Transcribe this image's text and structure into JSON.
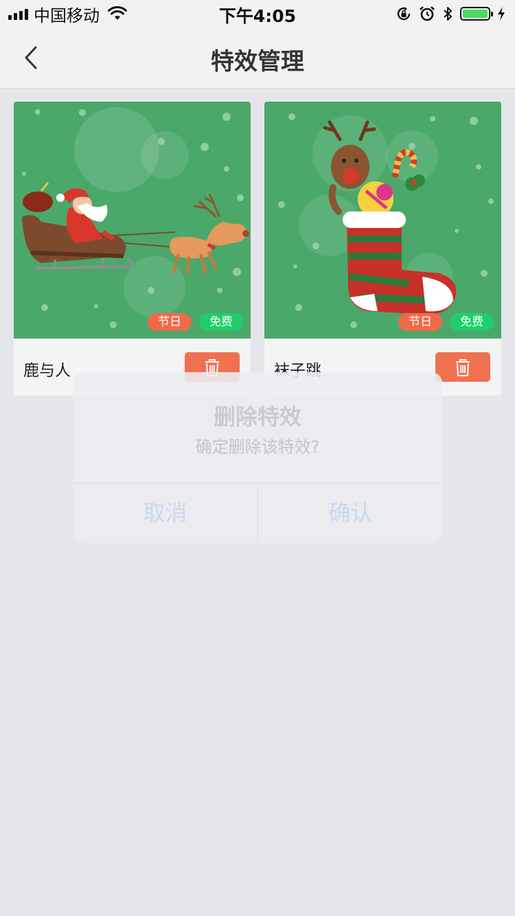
{
  "status_bar": {
    "carrier": "中国移动",
    "time": "下午4:05",
    "battery_level": 1.0,
    "icons": [
      "signal-icon",
      "wifi-icon",
      "rotation-lock-icon",
      "alarm-icon",
      "bluetooth-icon",
      "battery-icon",
      "charging-icon"
    ]
  },
  "nav": {
    "title": "特效管理",
    "back_icon": "chevron-left-icon"
  },
  "effects": [
    {
      "name": "鹿与人",
      "tags": [
        "节日",
        "免费"
      ],
      "delete_icon": "trash-icon"
    },
    {
      "name": "袜子跳",
      "tags": [
        "节日",
        "免费"
      ],
      "delete_icon": "trash-icon"
    }
  ],
  "dialog": {
    "title": "删除特效",
    "message": "确定删除该特效?",
    "cancel_label": "取消",
    "confirm_label": "确认"
  },
  "colors": {
    "accent_delete": "#f07150",
    "tag_holiday": "#f06a4a",
    "tag_free": "#1fce6a",
    "thumbnail_bg": "#4aa86a"
  }
}
